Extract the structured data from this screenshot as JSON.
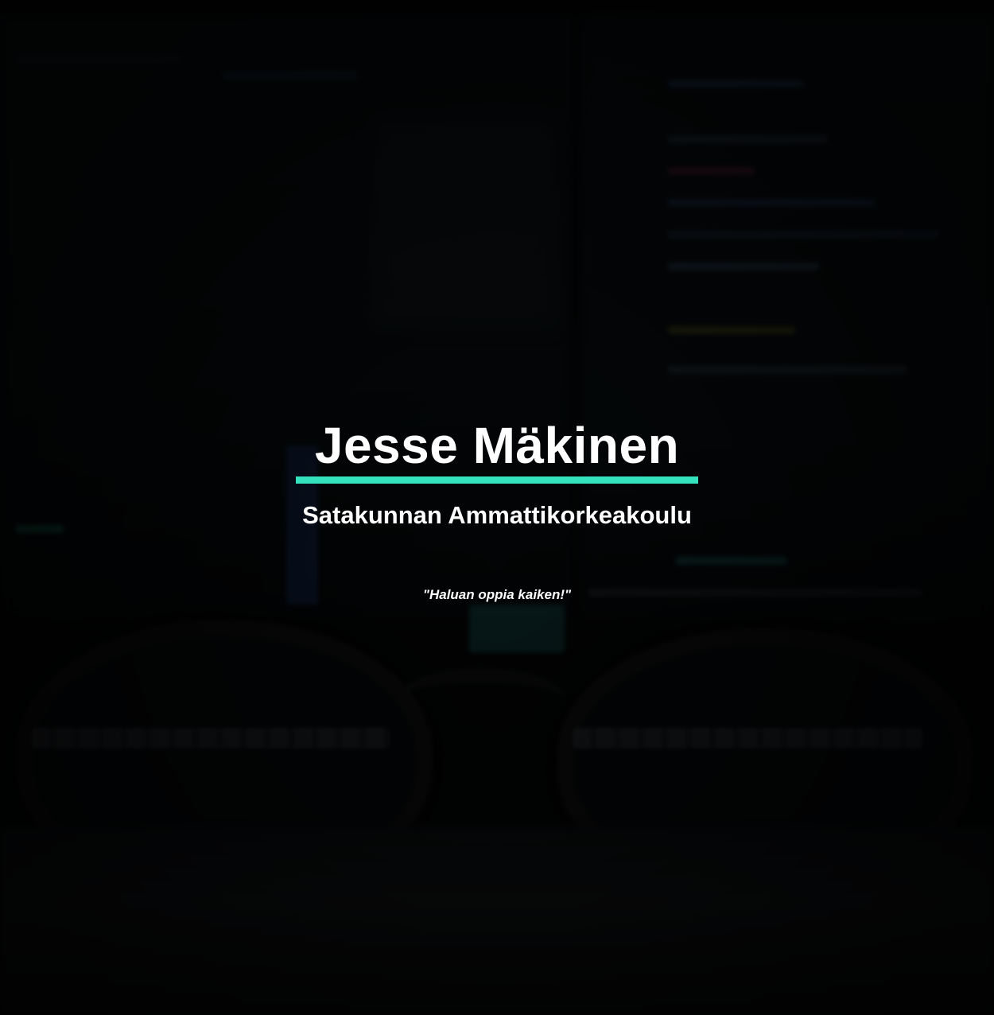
{
  "hero": {
    "name": "Jesse Mäkinen",
    "school": "Satakunnan Ammattikorkeakoulu",
    "quote": "\"Haluan oppia kaiken!\""
  },
  "colors": {
    "accent": "#34e2be",
    "text": "#ffffff",
    "background": "#050708"
  }
}
